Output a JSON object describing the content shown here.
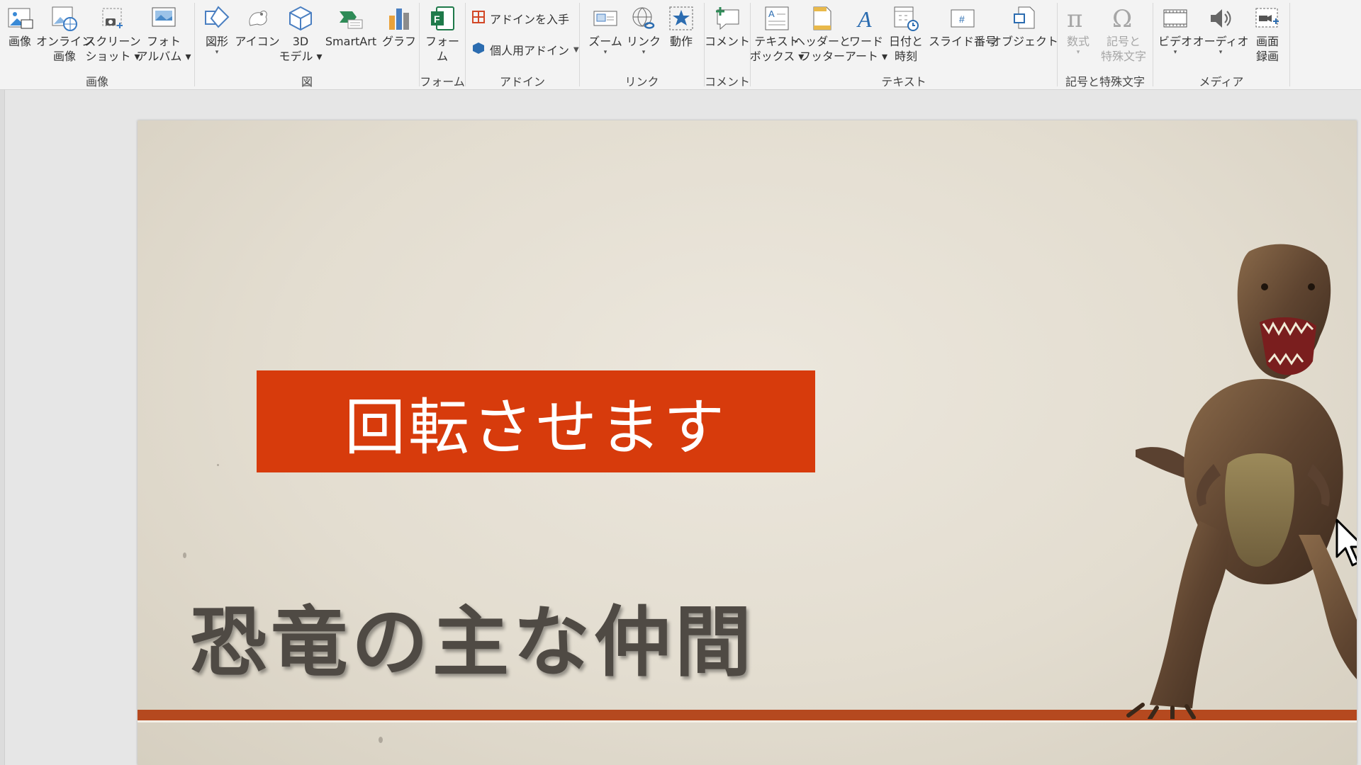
{
  "ribbon": {
    "groups": {
      "images": {
        "label": "画像",
        "buttons": [
          {
            "line1": "画像",
            "line2": ""
          },
          {
            "line1": "オンライン",
            "line2": "画像"
          },
          {
            "line1": "スクリーン",
            "line2": "ショット ▾"
          },
          {
            "line1": "フォト",
            "line2": "アルバム ▾"
          }
        ]
      },
      "illustrations": {
        "label": "図",
        "buttons": [
          {
            "line1": "図形",
            "line2": "▾"
          },
          {
            "line1": "アイコン",
            "line2": ""
          },
          {
            "line1": "3D",
            "line2": "モデル ▾"
          },
          {
            "line1": "SmartArt",
            "line2": ""
          },
          {
            "line1": "グラフ",
            "line2": ""
          }
        ]
      },
      "forms": {
        "label": "フォーム",
        "buttons": [
          {
            "line1": "フォー",
            "line2": "ム"
          }
        ]
      },
      "addins": {
        "label": "アドイン",
        "get_addins": "アドインを入手",
        "my_addins": "個人用アドイン"
      },
      "links": {
        "label": "リンク",
        "buttons": [
          {
            "line1": "ズーム",
            "line2": "▾"
          },
          {
            "line1": "リンク",
            "line2": "▾"
          },
          {
            "line1": "動作",
            "line2": ""
          }
        ]
      },
      "comments": {
        "label": "コメント",
        "buttons": [
          {
            "line1": "コメント",
            "line2": ""
          }
        ]
      },
      "text": {
        "label": "テキスト",
        "buttons": [
          {
            "line1": "テキスト",
            "line2": "ボックス ▾"
          },
          {
            "line1": "ヘッダーと",
            "line2": "フッター"
          },
          {
            "line1": "ワード",
            "line2": "アート ▾"
          },
          {
            "line1": "日付と",
            "line2": "時刻"
          },
          {
            "line1": "スライド番号",
            "line2": ""
          },
          {
            "line1": "オブジェクト",
            "line2": ""
          }
        ]
      },
      "symbols": {
        "label": "記号と特殊文字",
        "buttons": [
          {
            "line1": "数式",
            "line2": "▾"
          },
          {
            "line1": "記号と",
            "line2": "特殊文字"
          }
        ]
      },
      "media": {
        "label": "メディア",
        "buttons": [
          {
            "line1": "ビデオ",
            "line2": "▾"
          },
          {
            "line1": "オーディオ",
            "line2": "▾"
          },
          {
            "line1": "画面",
            "line2": "録画"
          }
        ]
      }
    }
  },
  "slide": {
    "callout_text": "回転させます",
    "title": "恐竜の主な仲間",
    "colors": {
      "callout_fill": "#d73b0c",
      "accent_bar": "#b5491f",
      "title_text": "#4f4a44",
      "background": "#e3ddd0"
    }
  },
  "icons": [
    "image-icon",
    "online-image-icon",
    "screenshot-icon",
    "photo-album-icon",
    "shapes-icon",
    "icons-icon",
    "3d-model-icon",
    "smartart-icon",
    "chart-icon",
    "forms-icon",
    "get-addins-icon",
    "my-addins-icon",
    "zoom-icon",
    "link-icon",
    "action-icon",
    "comment-icon",
    "textbox-icon",
    "header-footer-icon",
    "wordart-icon",
    "datetime-icon",
    "slide-number-icon",
    "object-icon",
    "equation-icon",
    "symbol-icon",
    "video-icon",
    "audio-icon",
    "screen-recording-icon",
    "mouse-cursor-icon"
  ]
}
